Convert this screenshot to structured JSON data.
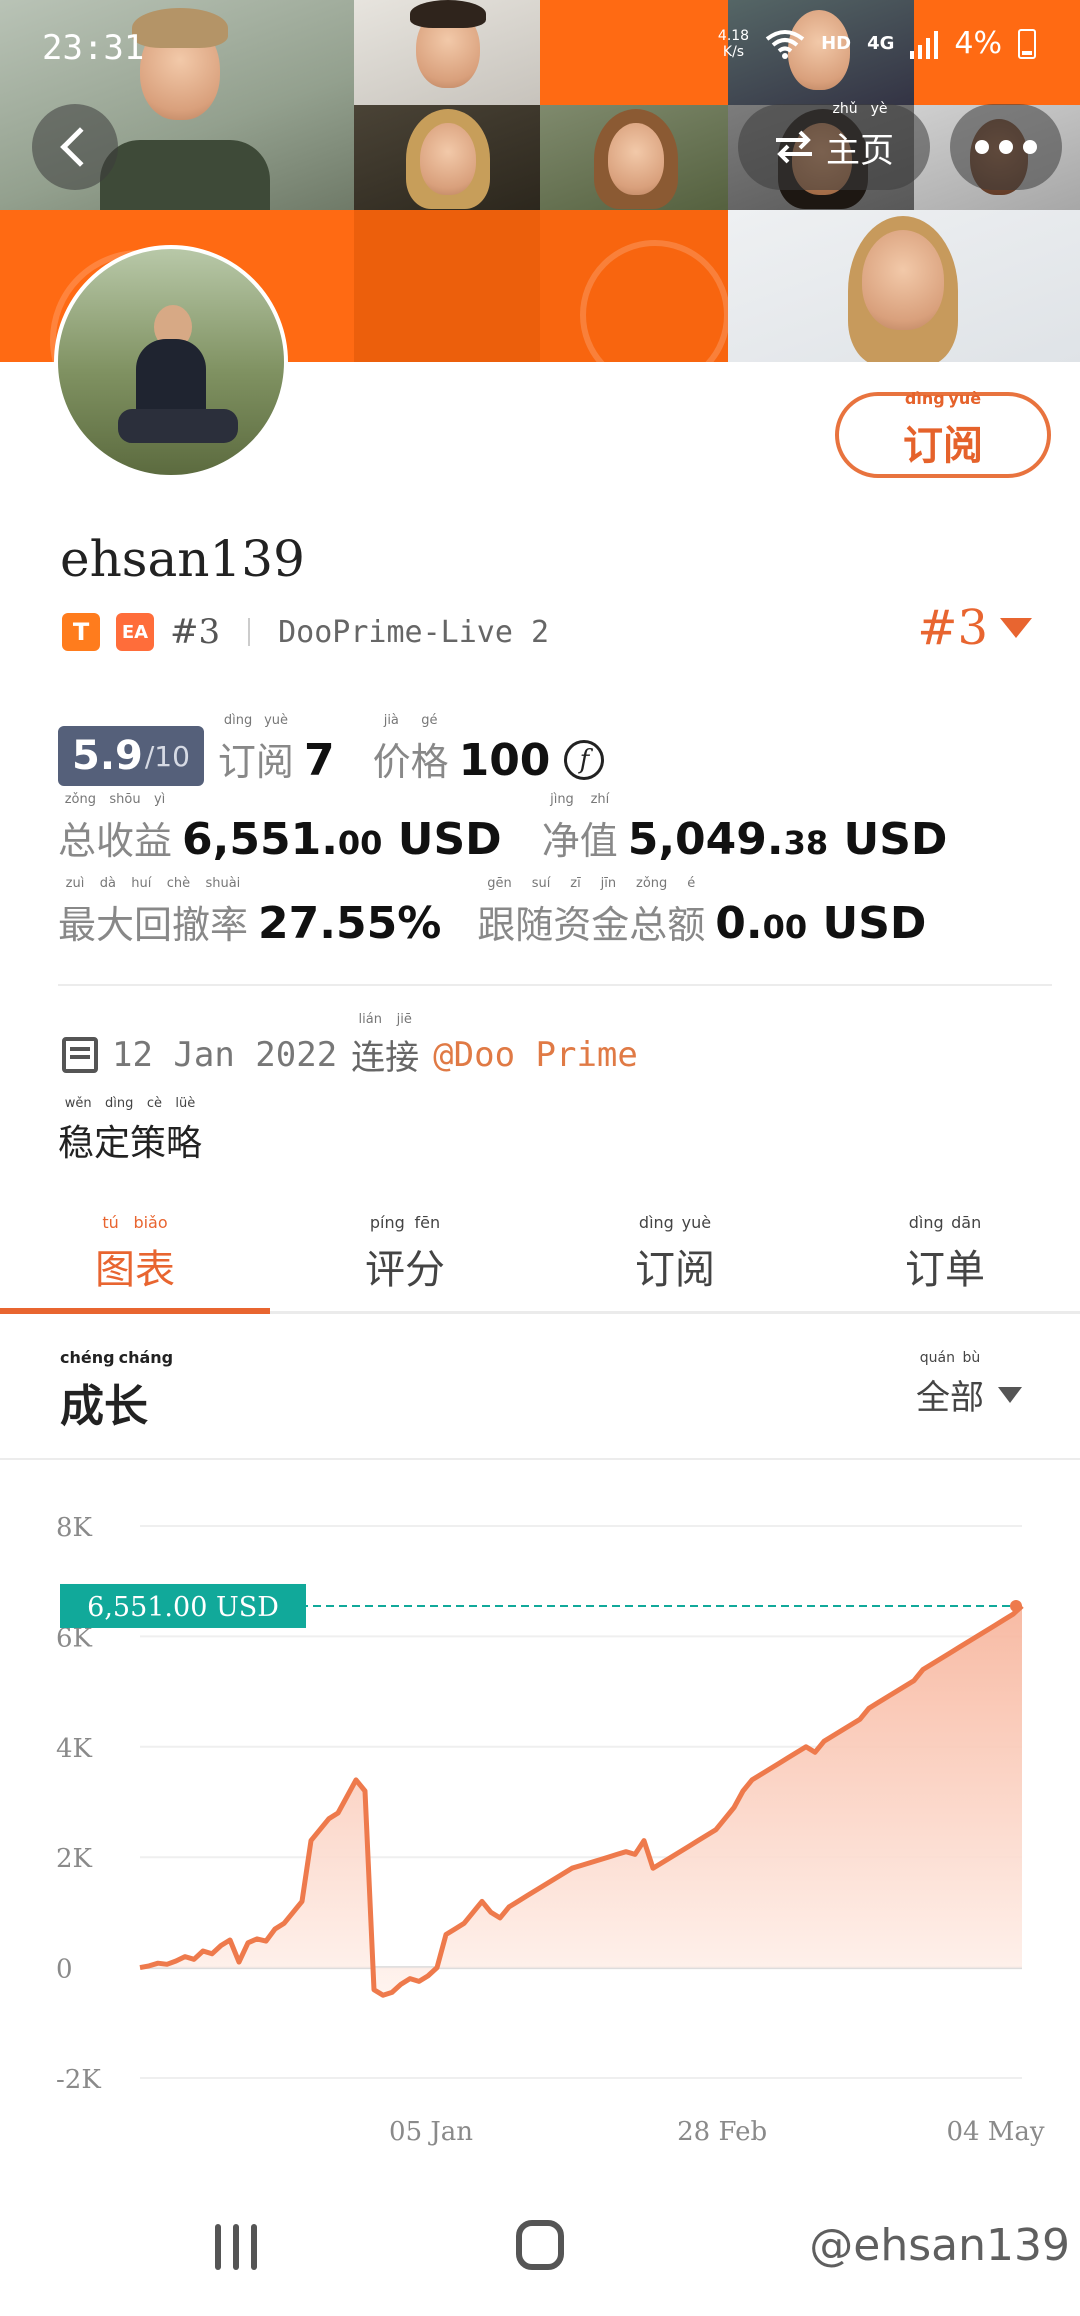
{
  "status_bar": {
    "time": "23:31",
    "net_speed_top": "4.18",
    "net_speed_bottom": "K/s",
    "hd": "HD",
    "network": "4G",
    "battery": "4%"
  },
  "header": {
    "home_label": "主页",
    "home_pinyin": [
      "zhǔ",
      "yè"
    ]
  },
  "profile": {
    "subscribe_label": "订阅",
    "subscribe_pinyin": [
      "dìng",
      "yuè"
    ],
    "username": "ehsan139",
    "badge_t": "T",
    "badge_ea": "EA",
    "rank_small": "#3",
    "server": "DooPrime-Live 2",
    "rank_big": "#3"
  },
  "stats": {
    "score": "5.9",
    "score_total": "/10",
    "subscribe_label": "订阅",
    "subscribe_pinyin": [
      "dìng",
      "yuè"
    ],
    "subscribe_count": "7",
    "price_label": "价格",
    "price_pinyin": [
      "jià",
      "gé"
    ],
    "price_value": "100",
    "price_icon": "coin-f-icon",
    "total_profit_label": "总收益",
    "total_profit_pinyin": [
      "zǒng",
      "shōu",
      "yì"
    ],
    "total_profit_int": "6,551.",
    "total_profit_dec": "00",
    "total_profit_unit": " USD",
    "net_value_label": "净值",
    "net_value_pinyin": [
      "jìng",
      "zhí"
    ],
    "net_value_int": "5,049.",
    "net_value_dec": "38",
    "net_value_unit": " USD",
    "max_drawdown_label": "最大回撤率",
    "max_drawdown_pinyin": [
      "zuì",
      "dà",
      "huí",
      "chè",
      "shuài"
    ],
    "max_drawdown_value": "27.55%",
    "follow_funds_label": "跟随资金总额",
    "follow_funds_pinyin": [
      "gēn",
      "suí",
      "zī",
      "jīn",
      "zǒng",
      "é"
    ],
    "follow_funds_int": "0.",
    "follow_funds_dec": "00",
    "follow_funds_unit": " USD"
  },
  "meta": {
    "date": "12 Jan 2022",
    "connect_label": "连接",
    "connect_pinyin": [
      "lián",
      "jiē"
    ],
    "broker_link": "@Doo Prime",
    "strategy": "稳定策略",
    "strategy_pinyin": [
      "wěn",
      "dìng",
      "cè",
      "lüè"
    ]
  },
  "tabs": [
    {
      "label": "图表",
      "pinyin": [
        "tú",
        "biǎo"
      ],
      "active": true
    },
    {
      "label": "评分",
      "pinyin": [
        "píng",
        "fēn"
      ],
      "active": false
    },
    {
      "label": "订阅",
      "pinyin": [
        "dìng",
        "yuè"
      ],
      "active": false
    },
    {
      "label": "订单",
      "pinyin": [
        "dìng",
        "dān"
      ],
      "active": false
    }
  ],
  "growth": {
    "title": "成长",
    "title_pinyin": [
      "chéng",
      "cháng"
    ],
    "filter_label": "全部",
    "filter_pinyin": [
      "quán",
      "bù"
    ]
  },
  "chart_data": {
    "type": "area",
    "current_value_label": "6,551.00 USD",
    "current_value": 6551,
    "y_ticks": [
      "8K",
      "6K",
      "4K",
      "2K",
      "0",
      "-2K"
    ],
    "y_tick_values": [
      8000,
      6000,
      4000,
      2000,
      0,
      -2000
    ],
    "ylim": [
      -2000,
      8000
    ],
    "x_tick_labels": [
      "05 Jan",
      "28 Feb",
      "04 May"
    ],
    "x_tick_positions": [
      0.33,
      0.66,
      0.97
    ],
    "series": [
      {
        "values": [
          0,
          30,
          80,
          60,
          120,
          200,
          150,
          300,
          250,
          400,
          500,
          100,
          450,
          520,
          480,
          700,
          800,
          1000,
          1200,
          2300,
          2500,
          2700,
          2800,
          3100,
          3400,
          3200,
          -400,
          -500,
          -450,
          -300,
          -200,
          -250,
          -150,
          0,
          600,
          700,
          800,
          1000,
          1200,
          1000,
          900,
          1100,
          1200,
          1300,
          1400,
          1500,
          1600,
          1700,
          1800,
          1850,
          1900,
          1950,
          2000,
          2050,
          2100,
          2050,
          2300,
          1800,
          1900,
          2000,
          2100,
          2200,
          2300,
          2400,
          2500,
          2700,
          2900,
          3200,
          3400,
          3500,
          3600,
          3700,
          3800,
          3900,
          4000,
          3900,
          4100,
          4200,
          4300,
          4400,
          4500,
          4700,
          4800,
          4900,
          5000,
          5100,
          5200,
          5400,
          5500,
          5600,
          5700,
          5800,
          5900,
          6000,
          6100,
          6200,
          6300,
          6400,
          6551
        ]
      }
    ],
    "colors": {
      "line": "#ee7a4c",
      "fill_top": "#f7b39a",
      "fill_bottom": "#fff3ee",
      "current_tag": "#11a99a"
    }
  },
  "navbar": {
    "watermark": "@ehsan139"
  }
}
